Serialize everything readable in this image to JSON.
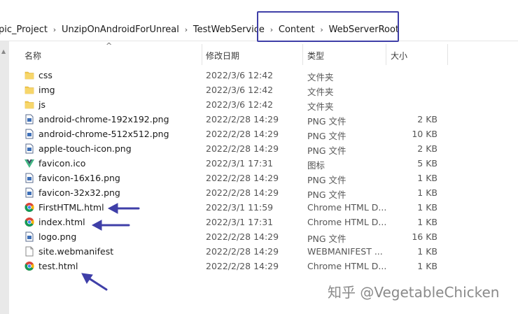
{
  "breadcrumbs": [
    "pic_Project",
    "UnzipOnAndroidForUnreal",
    "TestWebService",
    "Content",
    "WebServerRoot"
  ],
  "columns": {
    "name": "名称",
    "date": "修改日期",
    "type": "类型",
    "size": "大小"
  },
  "files": [
    {
      "name": "css",
      "date": "2022/3/6 12:42",
      "type": "文件夹",
      "size": "",
      "icon": "folder-icon"
    },
    {
      "name": "img",
      "date": "2022/3/6 12:42",
      "type": "文件夹",
      "size": "",
      "icon": "folder-icon"
    },
    {
      "name": "js",
      "date": "2022/3/6 12:42",
      "type": "文件夹",
      "size": "",
      "icon": "folder-icon"
    },
    {
      "name": "android-chrome-192x192.png",
      "date": "2022/2/28 14:29",
      "type": "PNG 文件",
      "size": "2 KB",
      "icon": "image-file-icon"
    },
    {
      "name": "android-chrome-512x512.png",
      "date": "2022/2/28 14:29",
      "type": "PNG 文件",
      "size": "10 KB",
      "icon": "image-file-icon"
    },
    {
      "name": "apple-touch-icon.png",
      "date": "2022/2/28 14:29",
      "type": "PNG 文件",
      "size": "2 KB",
      "icon": "image-file-icon"
    },
    {
      "name": "favicon.ico",
      "date": "2022/3/1 17:31",
      "type": "图标",
      "size": "5 KB",
      "icon": "vue-logo-icon"
    },
    {
      "name": "favicon-16x16.png",
      "date": "2022/2/28 14:29",
      "type": "PNG 文件",
      "size": "1 KB",
      "icon": "image-file-icon"
    },
    {
      "name": "favicon-32x32.png",
      "date": "2022/2/28 14:29",
      "type": "PNG 文件",
      "size": "1 KB",
      "icon": "image-file-icon"
    },
    {
      "name": "FirstHTML.html",
      "date": "2022/3/1 11:59",
      "type": "Chrome HTML D...",
      "size": "1 KB",
      "icon": "chrome-icon"
    },
    {
      "name": "index.html",
      "date": "2022/3/1 17:31",
      "type": "Chrome HTML D...",
      "size": "1 KB",
      "icon": "chrome-icon"
    },
    {
      "name": "logo.png",
      "date": "2022/2/28 14:29",
      "type": "PNG 文件",
      "size": "16 KB",
      "icon": "image-file-icon"
    },
    {
      "name": "site.webmanifest",
      "date": "2022/2/28 14:29",
      "type": "WEBMANIFEST ...",
      "size": "1 KB",
      "icon": "blank-file-icon"
    },
    {
      "name": "test.html",
      "date": "2022/2/28 14:29",
      "type": "Chrome HTML D...",
      "size": "1 KB",
      "icon": "chrome-icon"
    }
  ],
  "watermark": "知乎 @VegetableChicken",
  "colors": {
    "annotation": "#3f3fa8",
    "folder": "#f2c94c"
  }
}
